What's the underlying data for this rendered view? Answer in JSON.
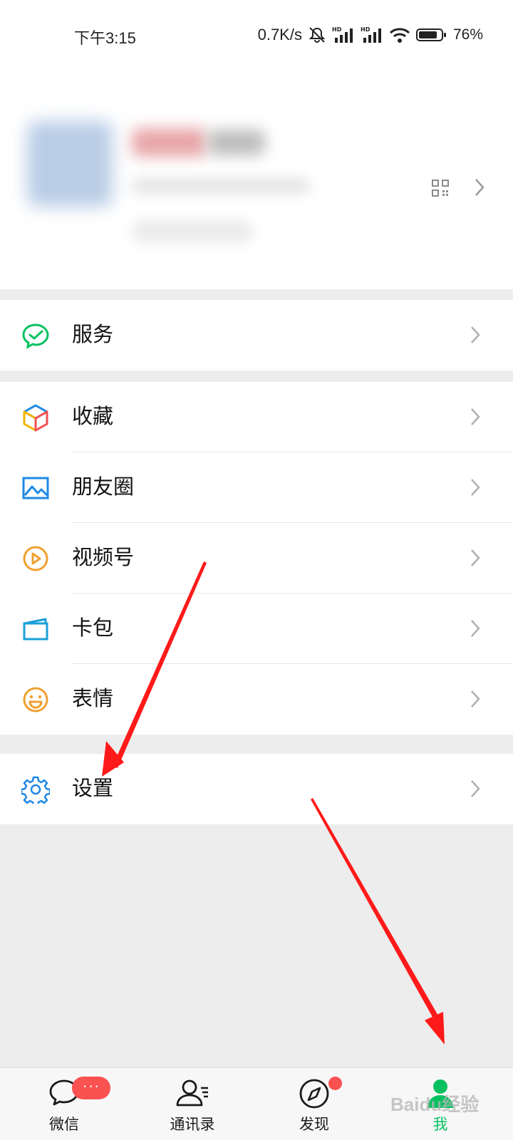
{
  "status_bar": {
    "time": "下午3:15",
    "net_speed": "0.7K/s",
    "battery": "76%",
    "icons": [
      "mute-bell-icon",
      "hd-signal-icon",
      "hd-signal-icon",
      "wifi-icon",
      "battery-icon"
    ]
  },
  "profile": {
    "blurred": true,
    "icons": [
      "qr-code-icon",
      "chevron-right-icon"
    ]
  },
  "menu": {
    "service": {
      "label": "服务",
      "icon": "wechat-pay-icon",
      "color": "#07c160"
    },
    "favorites": {
      "label": "收藏",
      "icon": "cube-icon"
    },
    "moments": {
      "label": "朋友圈",
      "icon": "picture-icon",
      "color": "#1e88e5"
    },
    "channels": {
      "label": "视频号",
      "icon": "play-circle-icon",
      "color": "#f0a030"
    },
    "cards": {
      "label": "卡包",
      "icon": "card-wallet-icon",
      "color": "#1aa0d8"
    },
    "stickers": {
      "label": "表情",
      "icon": "smiley-icon",
      "color": "#f0a030"
    },
    "settings": {
      "label": "设置",
      "icon": "gear-icon",
      "color": "#1e88e5"
    }
  },
  "tabs": [
    {
      "label": "微信",
      "icon": "chat-bubble-icon",
      "badge": "···"
    },
    {
      "label": "通讯录",
      "icon": "contacts-icon"
    },
    {
      "label": "发现",
      "icon": "compass-icon",
      "dot": true
    },
    {
      "label": "我",
      "icon": "me-person-icon",
      "active": true
    }
  ],
  "watermark": "Baidu经验",
  "colors": {
    "accent": "#07c160",
    "badge": "#fa5151",
    "annotation_arrow": "#ff1a1a"
  }
}
